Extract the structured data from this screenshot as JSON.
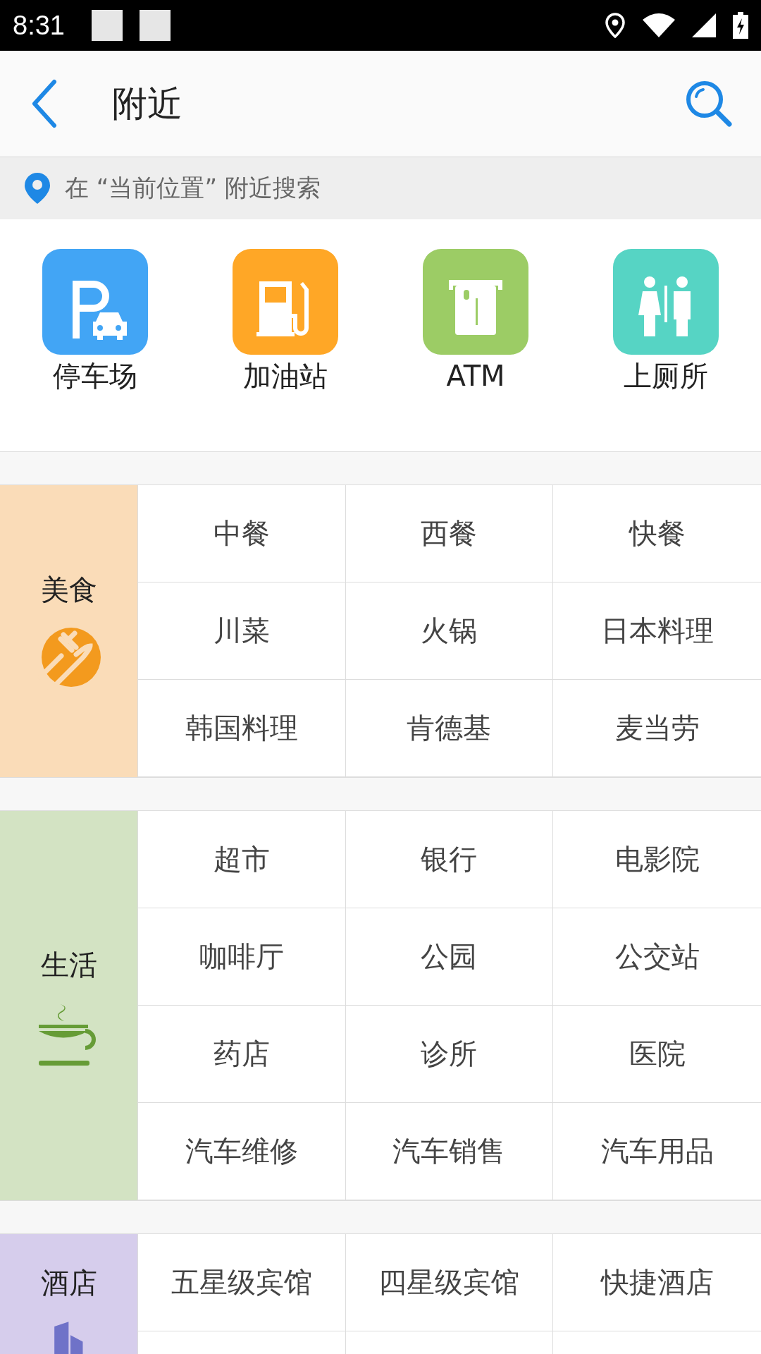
{
  "status_bar": {
    "time": "8:31"
  },
  "header": {
    "title": "附近"
  },
  "search_bar": {
    "text": "在 “当前位置” 附近搜索"
  },
  "quick_links": [
    {
      "kind": "parking",
      "label": "停车场",
      "color": "#42a5f5"
    },
    {
      "kind": "fuel",
      "label": "加油站",
      "color": "#ffa726"
    },
    {
      "kind": "atm",
      "label": "ATM",
      "color": "#9ccc65"
    },
    {
      "kind": "toilet",
      "label": "上厕所",
      "color": "#56d4c4"
    }
  ],
  "sections": [
    {
      "kind": "food",
      "title": "美食",
      "color": "#fadcb8",
      "items": [
        "中餐",
        "西餐",
        "快餐",
        "川菜",
        "火锅",
        "日本料理",
        "韩国料理",
        "肯德基",
        "麦当劳"
      ]
    },
    {
      "kind": "life",
      "title": "生活",
      "color": "#d3e3c3",
      "items": [
        "超市",
        "银行",
        "电影院",
        "咖啡厅",
        "公园",
        "公交站",
        "药店",
        "诊所",
        "医院",
        "汽车维修",
        "汽车销售",
        "汽车用品"
      ]
    },
    {
      "kind": "hotel",
      "title": "酒店",
      "color": "#d6cdec",
      "items": [
        "五星级宾馆",
        "四星级宾馆",
        "快捷酒店"
      ]
    }
  ]
}
